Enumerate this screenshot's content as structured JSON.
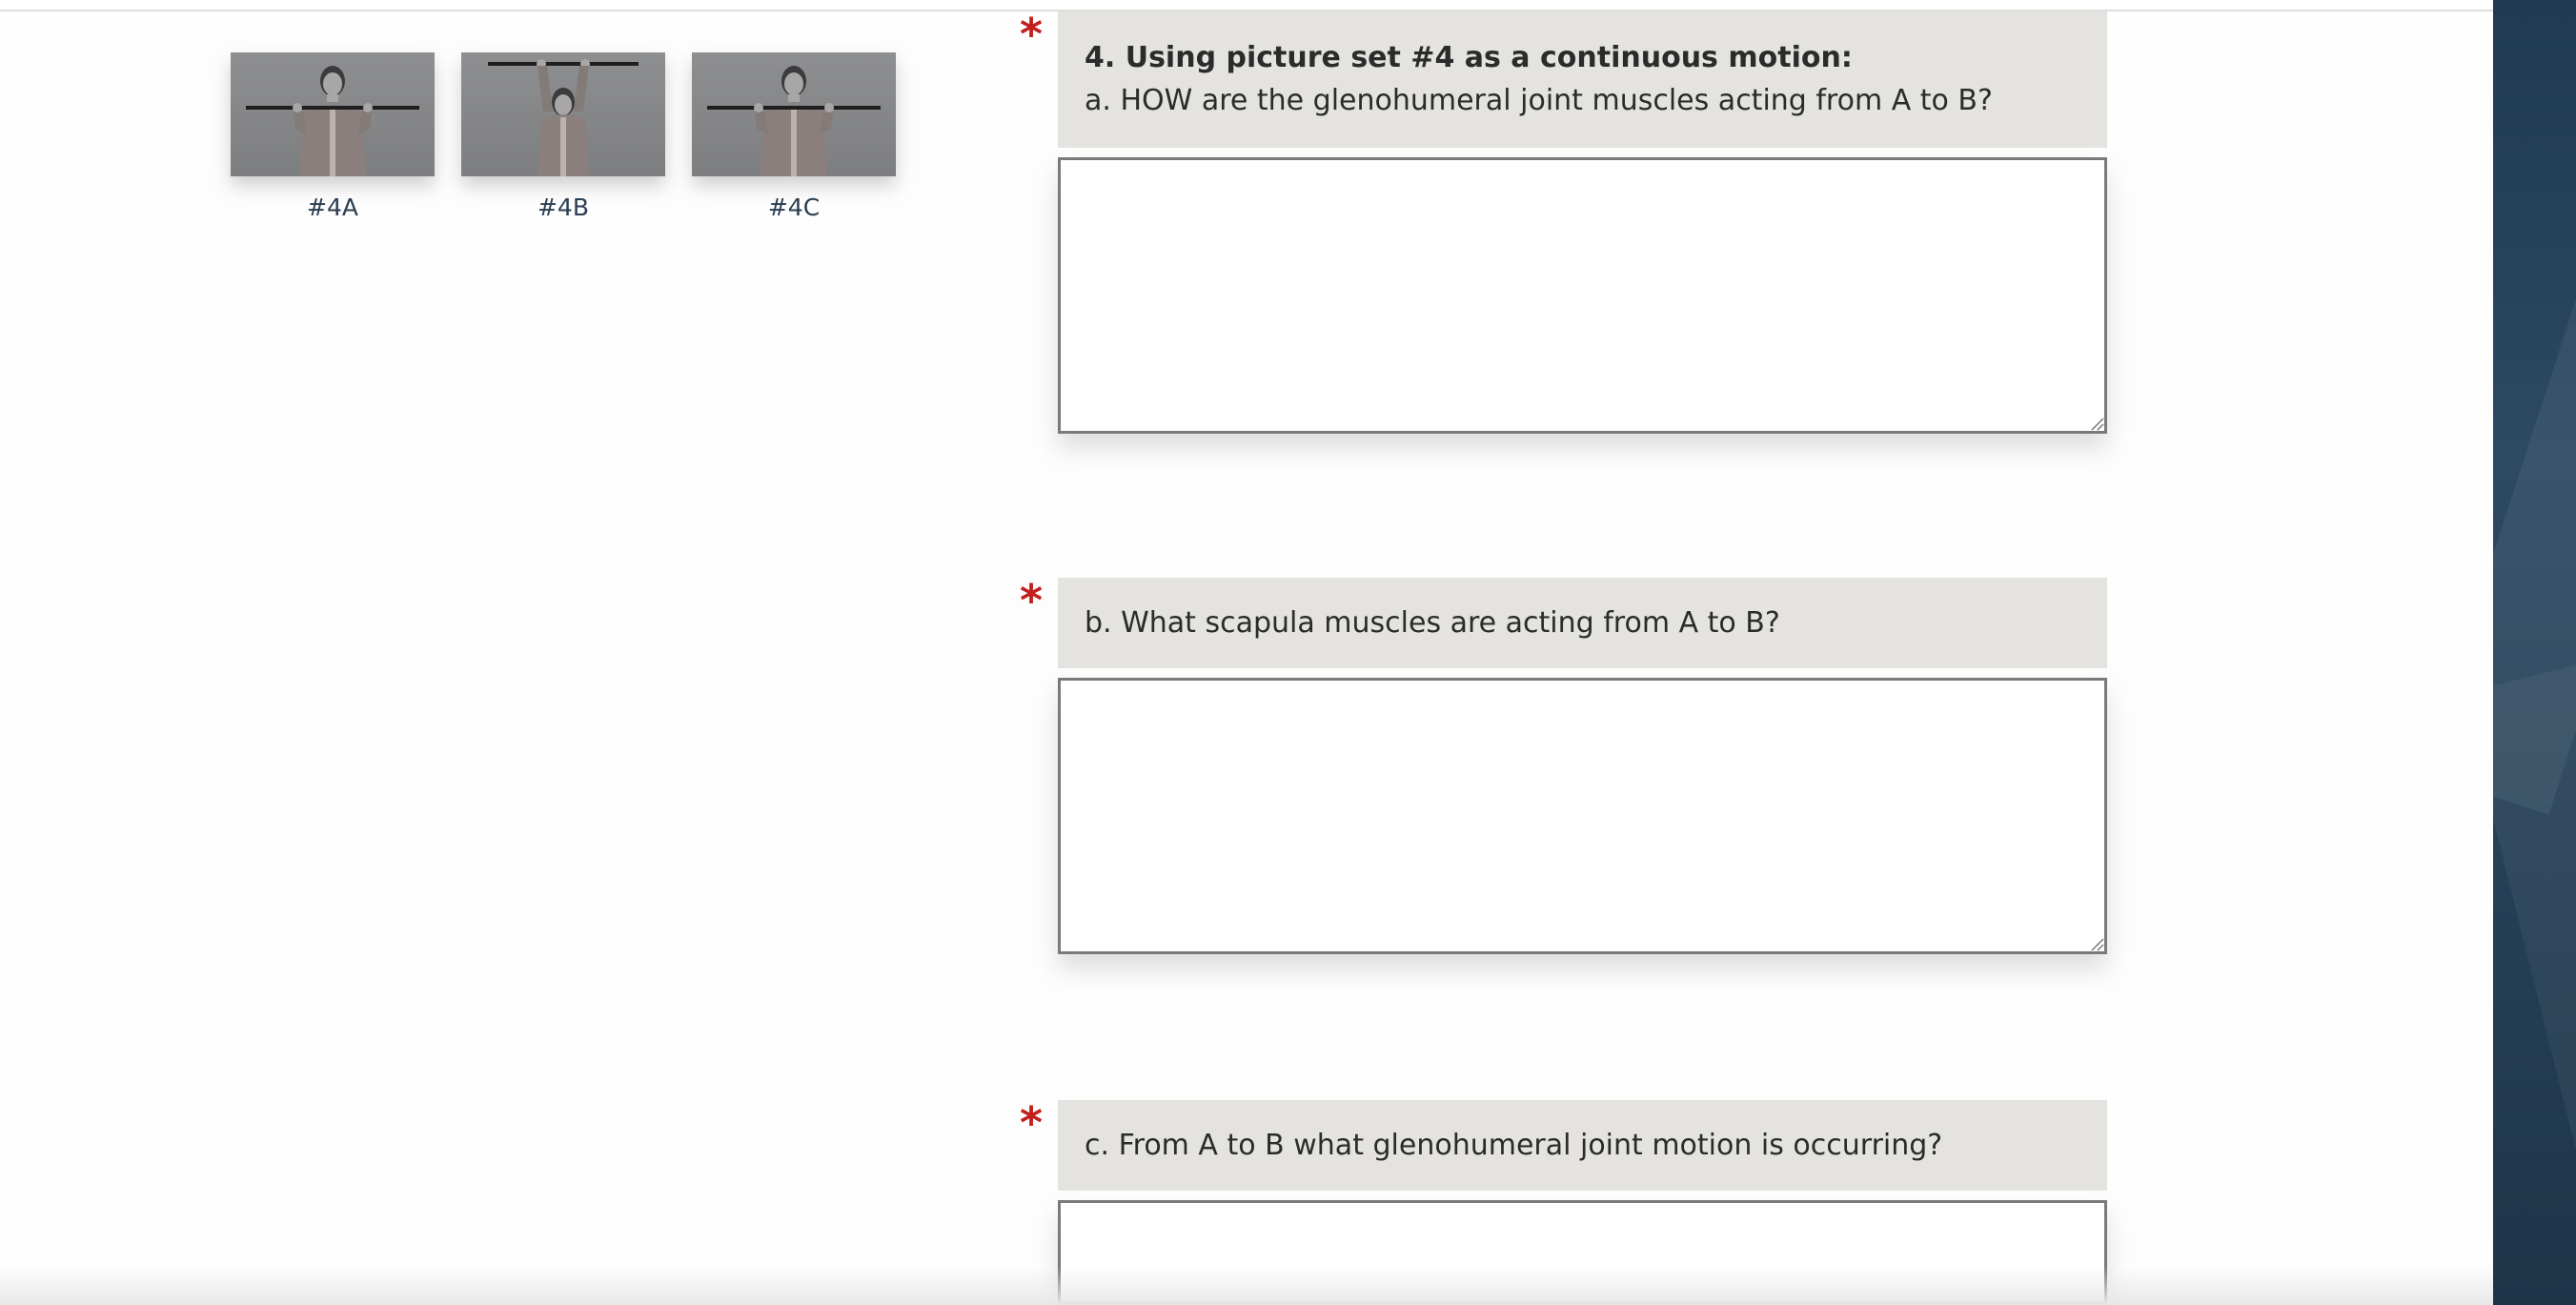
{
  "images": [
    {
      "label": "#4A",
      "arms": "shoulder",
      "alt_icon": "person-holding-bar-icon"
    },
    {
      "label": "#4B",
      "arms": "overhead",
      "alt_icon": "person-holding-bar-overhead-icon"
    },
    {
      "label": "#4C",
      "arms": "shoulder",
      "alt_icon": "person-holding-bar-icon"
    }
  ],
  "required_marker": "*",
  "colors": {
    "required": "#c0201e",
    "prompt_bg": "#e4e3df",
    "side_panel": "#274259"
  },
  "questions": [
    {
      "heading": "4. Using picture set #4 as a continuous motion:",
      "text": "a. HOW are the glenohumeral joint muscles acting from A to B?",
      "answer": ""
    },
    {
      "heading": "",
      "text": "b. What scapula muscles are acting from A to B?",
      "answer": ""
    },
    {
      "heading": "",
      "text": "c. From A to B what glenohumeral joint motion is occurring?",
      "answer": ""
    }
  ]
}
